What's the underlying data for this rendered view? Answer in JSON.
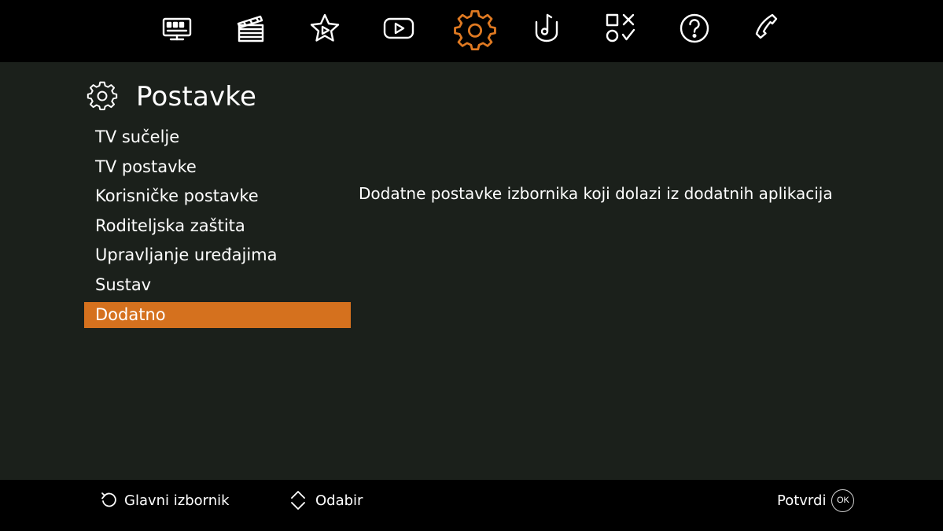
{
  "nav": {
    "items": [
      {
        "icon": "tv-guide-icon",
        "active": false
      },
      {
        "icon": "clapperboard-icon",
        "active": false
      },
      {
        "icon": "star-play-icon",
        "active": false
      },
      {
        "icon": "play-icon",
        "active": false
      },
      {
        "icon": "settings-gear-icon",
        "active": true
      },
      {
        "icon": "music-note-icon",
        "active": false
      },
      {
        "icon": "apps-games-icon",
        "active": false
      },
      {
        "icon": "help-icon",
        "active": false
      },
      {
        "icon": "phone-icon",
        "active": false
      }
    ]
  },
  "header": {
    "icon": "settings-gear-icon",
    "title": "Postavke"
  },
  "menu": {
    "items": [
      {
        "label": "TV sučelje"
      },
      {
        "label": "TV postavke"
      },
      {
        "label": "Korisničke postavke"
      },
      {
        "label": "Roditeljska zaštita"
      },
      {
        "label": "Upravljanje uređajima"
      },
      {
        "label": "Sustav"
      },
      {
        "label": "Dodatno"
      }
    ],
    "selected_label": "Dodatno"
  },
  "description": "Dodatne postavke izbornika koji dolazi iz dodatnih aplikacija",
  "footer": {
    "back_label": "Glavni izbornik",
    "select_label": "Odabir",
    "confirm_label": "Potvrdi",
    "ok_badge": "OK"
  },
  "colors": {
    "accent": "#d5711e",
    "background": "#1b201b",
    "bar": "#000000",
    "text": "#ffffff"
  }
}
